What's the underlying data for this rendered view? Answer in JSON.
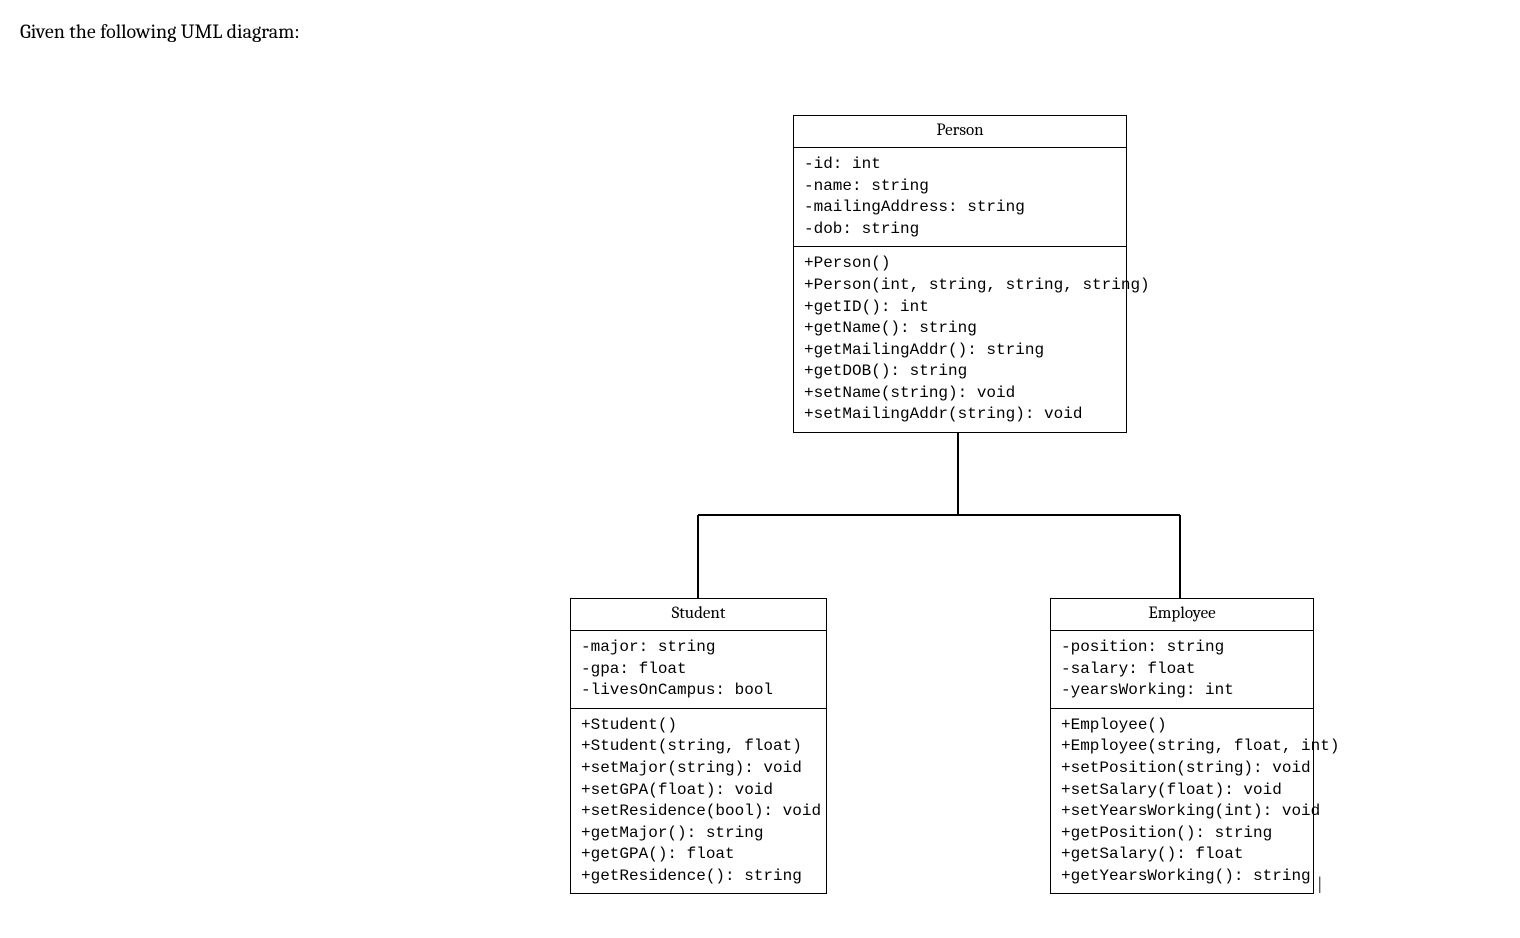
{
  "prompt": "Given the following UML diagram:",
  "classes": {
    "person": {
      "name": "Person",
      "attributes": [
        "-id: int",
        "-name: string",
        "-mailingAddress: string",
        "-dob: string"
      ],
      "methods": [
        "+Person()",
        "+Person(int, string, string, string)",
        "+getID(): int",
        "+getName(): string",
        "+getMailingAddr(): string",
        "+getDOB(): string",
        "+setName(string): void",
        "+setMailingAddr(string): void"
      ]
    },
    "student": {
      "name": "Student",
      "attributes": [
        "-major: string",
        "-gpa: float",
        "-livesOnCampus: bool"
      ],
      "methods": [
        "+Student()",
        "+Student(string, float)",
        "+setMajor(string): void",
        "+setGPA(float): void",
        "+setResidence(bool): void",
        "+getMajor(): string",
        "+getGPA(): float",
        "+getResidence(): string"
      ]
    },
    "employee": {
      "name": "Employee",
      "attributes": [
        "-position: string",
        "-salary: float",
        "-yearsWorking: int"
      ],
      "methods": [
        "+Employee()",
        "+Employee(string, float, int)",
        "+setPosition(string): void",
        "+setSalary(float): void",
        "+setYearsWorking(int): void",
        "+getPosition(): string",
        "+getSalary(): float",
        "+getYearsWorking(): string"
      ]
    }
  },
  "relationships": [
    {
      "type": "generalization",
      "from": "student",
      "to": "person"
    },
    {
      "type": "generalization",
      "from": "employee",
      "to": "person"
    }
  ],
  "cursor_text": "|"
}
